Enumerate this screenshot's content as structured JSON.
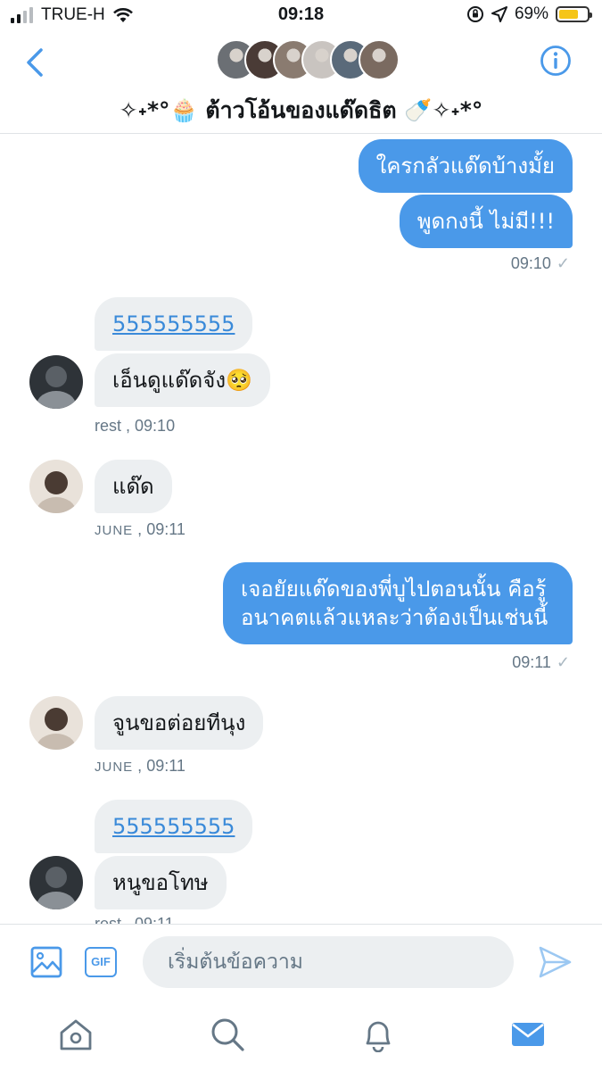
{
  "status_bar": {
    "carrier": "TRUE-H",
    "time": "09:18",
    "battery_percent": "69%",
    "battery_level": 0.69
  },
  "header": {
    "title": "✧˖*°🧁 ต้าวโอ้นของแด๊ดธิต 🍼✧˖*°",
    "avatar_colors": [
      "#6b6f74",
      "#4a3b36",
      "#8a7b70",
      "#c9c4c0",
      "#5a6a7a",
      "#7a6a60"
    ]
  },
  "messages": [
    {
      "dir": "out",
      "text": "ใครกลัวแด๊ดบ้างมั้ย"
    },
    {
      "dir": "out",
      "text": "พูดกงนี้ ไม่มี!!!"
    },
    {
      "dir": "out_meta",
      "time": "09:10"
    },
    {
      "dir": "in",
      "text": "555555555"
    },
    {
      "dir": "in",
      "text": "เอ็นดูแด๊ดจัง🥺"
    },
    {
      "dir": "in_meta",
      "sender": "rest",
      "time": "09:10"
    },
    {
      "dir": "in",
      "text": "แด๊ด"
    },
    {
      "dir": "in_meta",
      "sender": "JUNE",
      "time": "09:11"
    },
    {
      "dir": "out",
      "text": "เจอยัยแด๊ดของพี่บูไปตอนนั้น คือรู้อนาคตแล้วแหละว่าต้องเป็นเช่นนี้"
    },
    {
      "dir": "out_meta",
      "time": "09:11"
    },
    {
      "dir": "in",
      "text": "จูนขอต่อยทีนุง"
    },
    {
      "dir": "in_meta",
      "sender": "JUNE",
      "time": "09:11"
    },
    {
      "dir": "in",
      "text": "555555555"
    },
    {
      "dir": "in",
      "text": "หนูขอโทษ"
    },
    {
      "dir": "in_meta",
      "sender": "rest",
      "time": "09:11"
    }
  ],
  "composer": {
    "gif_label": "GIF",
    "placeholder": "เริ่มต้นข้อความ"
  },
  "icons": {
    "back": "chevron-left-icon",
    "info": "info-icon",
    "image": "image-icon",
    "send": "send-icon",
    "home": "home-icon",
    "search": "search-icon",
    "notifications": "bell-icon",
    "messages": "mail-icon"
  },
  "colors": {
    "accent": "#4a99e9",
    "incoming_bubble": "#eceff1",
    "meta_text": "#657786"
  }
}
